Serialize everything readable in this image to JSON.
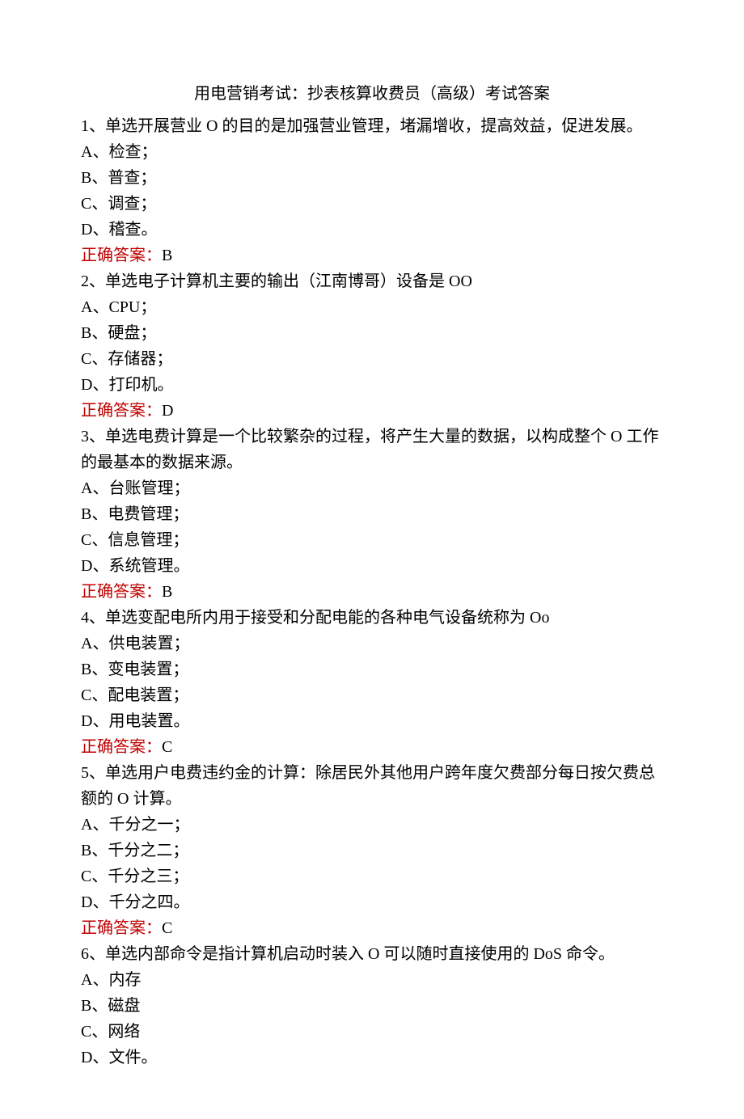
{
  "title": "用电营销考试：抄表核算收费员（高级）考试答案",
  "questions": [
    {
      "text": "1、单选开展营业 O 的目的是加强营业管理，堵漏增收，提高效益，促进发展。",
      "options": [
        "A、检查；",
        "B、普查；",
        "C、调查；",
        "D、稽查。"
      ],
      "answer_label": "正确答案：",
      "answer_value": "B"
    },
    {
      "text": "2、单选电子计算机主要的输出（江南博哥）设备是 OO",
      "options": [
        "A、CPU；",
        "B、硬盘；",
        "C、存储器；",
        "D、打印机。"
      ],
      "answer_label": "正确答案：",
      "answer_value": "D"
    },
    {
      "text": "3、单选电费计算是一个比较繁杂的过程，将产生大量的数据，以构成整个 O 工作的最基本的数据来源。",
      "options": [
        "A、台账管理；",
        "B、电费管理；",
        "C、信息管理；",
        "D、系统管理。"
      ],
      "answer_label": "正确答案：",
      "answer_value": "B"
    },
    {
      "text": "4、单选变配电所内用于接受和分配电能的各种电气设备统称为 Oo",
      "options": [
        "A、供电装置；",
        "B、变电装置；",
        "C、配电装置；",
        "D、用电装置。"
      ],
      "answer_label": "正确答案：",
      "answer_value": "C"
    },
    {
      "text": "5、单选用户电费违约金的计算：除居民外其他用户跨年度欠费部分每日按欠费总额的 O 计算。",
      "options": [
        "A、千分之一；",
        "B、千分之二；",
        "C、千分之三；",
        "D、千分之四。"
      ],
      "answer_label": "正确答案：",
      "answer_value": "C"
    },
    {
      "text": "6、单选内部命令是指计算机启动时装入 O 可以随时直接使用的 DoS 命令。",
      "options": [
        "A、内存",
        "B、磁盘",
        "C、网络",
        "D、文件。"
      ],
      "answer_label": "",
      "answer_value": ""
    }
  ]
}
